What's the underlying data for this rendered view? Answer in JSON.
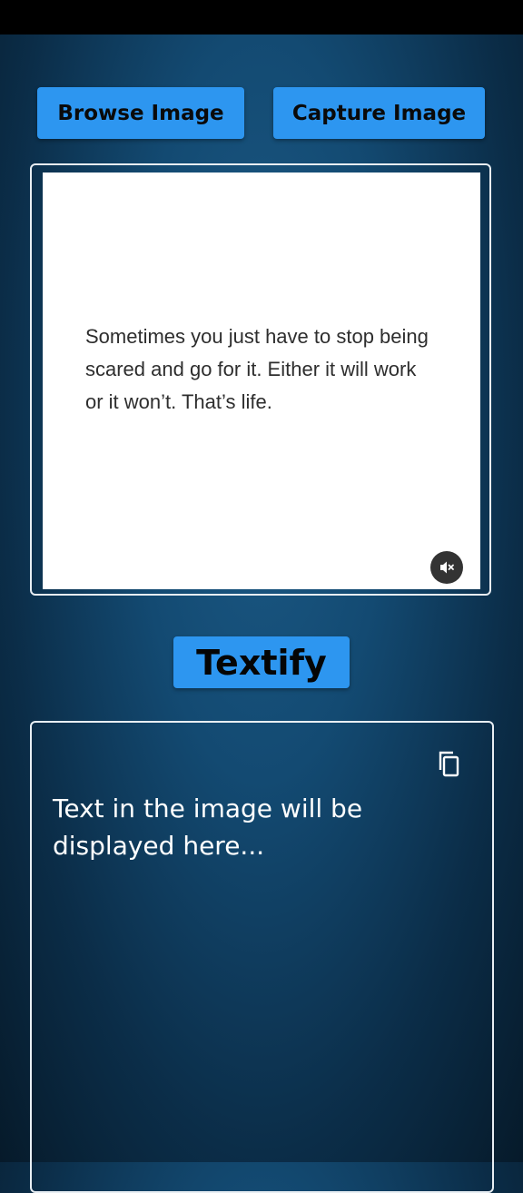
{
  "actions": {
    "browse_label": "Browse Image",
    "capture_label": "Capture Image",
    "textify_label": "Textify"
  },
  "preview": {
    "quote_lines": [
      "Sometimes you just have to stop being",
      "scared and go for it. Either it will work",
      "or it won’t. That’s life."
    ]
  },
  "output": {
    "placeholder_lines": [
      "Text in the image will be",
      "displayed here..."
    ]
  },
  "icons": {
    "mute": "volume-mute-icon",
    "copy": "copy-icon"
  },
  "colors": {
    "button": "#2d96f0",
    "background": "#134a72",
    "border": "#e8eef3"
  }
}
